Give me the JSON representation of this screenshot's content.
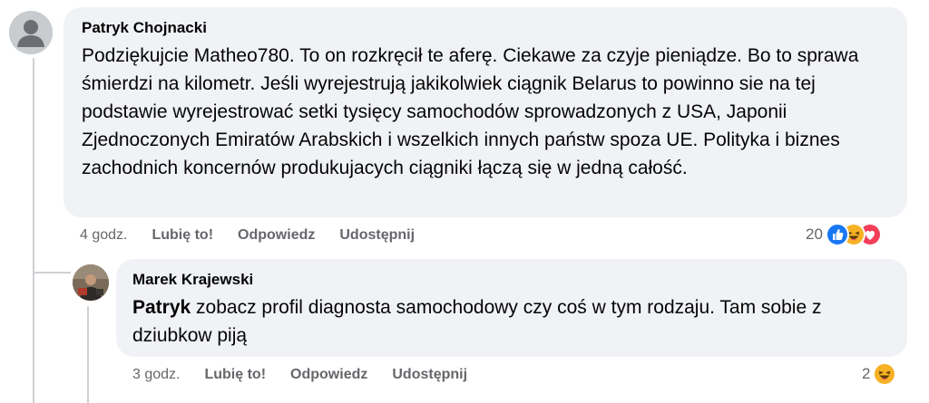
{
  "comments": [
    {
      "author": "Patryk Chojnacki",
      "avatar": "default-avatar-icon",
      "text": "Podziękujcie Matheo780. To on rozkręcił te aferę. Ciekawe za czyje pieniądze. Bo to sprawa śmierdzi na kilometr. Jeśli wyrejestrują jakikolwiek ciągnik Belarus to powinno sie na tej podstawie wyrejestrować setki tysięcy samochodów sprowadzonych z USA, Japonii Zjednoczonych Emiratów Arabskich i wszelkich innych państw spoza UE. Polityka i biznes zachodnich koncernów produkujacych ciągniki łączą się w jedną całość.",
      "time": "4 godz.",
      "like_label": "Lubię to!",
      "reply_label": "Odpowiedz",
      "share_label": "Udostępnij",
      "reaction_count": "20",
      "reactions": [
        "like-icon",
        "haha-icon",
        "love-icon"
      ]
    },
    {
      "author": "Marek Krajewski",
      "avatar": "profile-photo",
      "mention": "Patryk",
      "text": " zobacz profil diagnosta samochodowy czy coś w tym rodzaju. Tam sobie z dziubkow piją",
      "time": "3 godz.",
      "like_label": "Lubię to!",
      "reply_label": "Odpowiedz",
      "share_label": "Udostępnij",
      "reaction_count": "2",
      "reactions": [
        "haha-icon"
      ]
    }
  ],
  "colors": {
    "bubble": "#f0f2f5",
    "meta": "#65676b",
    "like": "#1877f2",
    "haha": "#f7b125",
    "love": "#f33e58"
  }
}
